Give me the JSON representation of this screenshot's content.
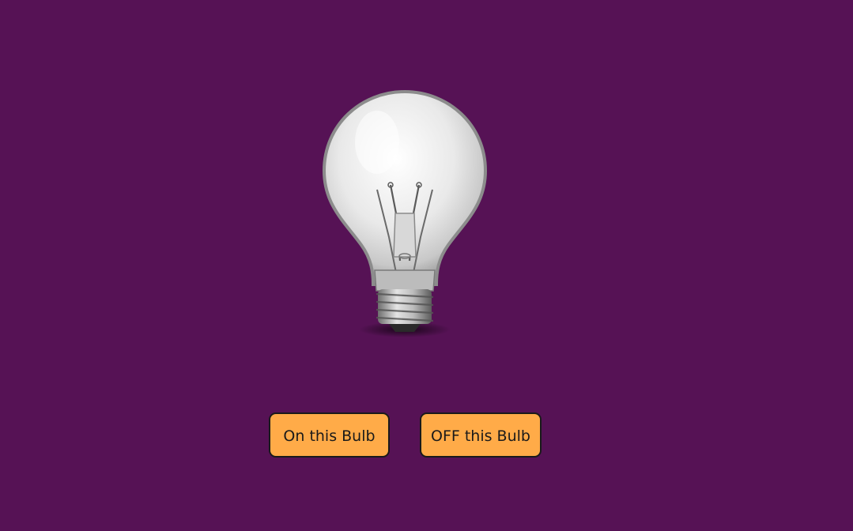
{
  "page": {
    "background_color": "#561255"
  },
  "bulb": {
    "icon": "light-bulb-icon",
    "state": "off"
  },
  "buttons": {
    "on_label": "On this Bulb",
    "off_label": "OFF this Bulb",
    "color": "#ffab48"
  }
}
